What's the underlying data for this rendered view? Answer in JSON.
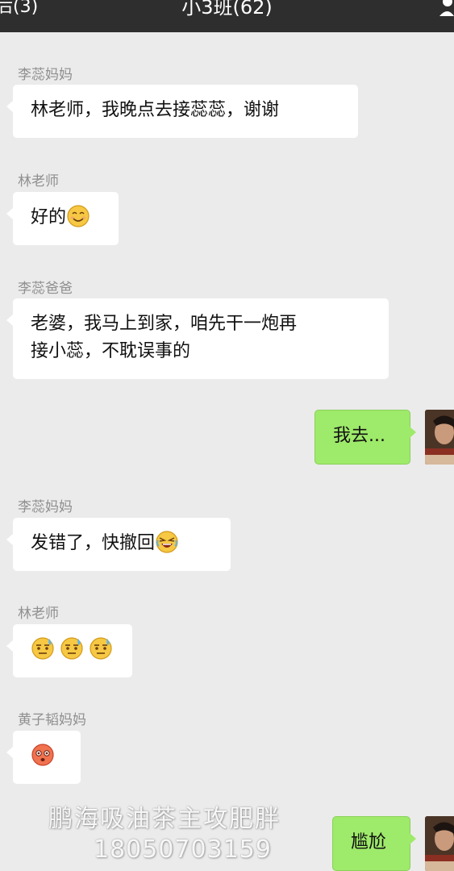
{
  "header": {
    "back_label": "后(3)",
    "title": "小3班(62)",
    "profile_icon": "person-icon"
  },
  "messages": [
    {
      "sender": "李蕊妈妈",
      "text": "林老师，我晚点去接蕊蕊，谢谢",
      "emojis": []
    },
    {
      "sender": "林老师",
      "text": "好的",
      "emojis": [
        "smile-emoji"
      ]
    },
    {
      "sender": "李蕊爸爸",
      "text": "老婆，我马上到家，咱先干一炮再\n接小蕊，不耽误事的",
      "emojis": []
    },
    {
      "sender": "",
      "text": "我去...",
      "emojis": [],
      "self": true
    },
    {
      "sender": "李蕊妈妈",
      "text": "发错了，快撤回",
      "emojis": [
        "crying-laugh-emoji"
      ]
    },
    {
      "sender": "林老师",
      "text": "",
      "emojis": [
        "sweat-emoji",
        "sweat-emoji",
        "sweat-emoji"
      ]
    },
    {
      "sender": "黄子韬妈妈",
      "text": "",
      "emojis": [
        "blush-shock-emoji"
      ]
    },
    {
      "sender": "",
      "text": "尴尬",
      "emojis": [],
      "self": true
    }
  ],
  "watermark": {
    "line1": "鹏海吸油茶主攻肥胖",
    "line2": "18050703159"
  },
  "colors": {
    "topbar": "#2e2e2e",
    "background": "#ebebeb",
    "self_bubble": "#9eea6a",
    "other_bubble": "#ffffff",
    "sender_name": "#8f8f8f"
  }
}
